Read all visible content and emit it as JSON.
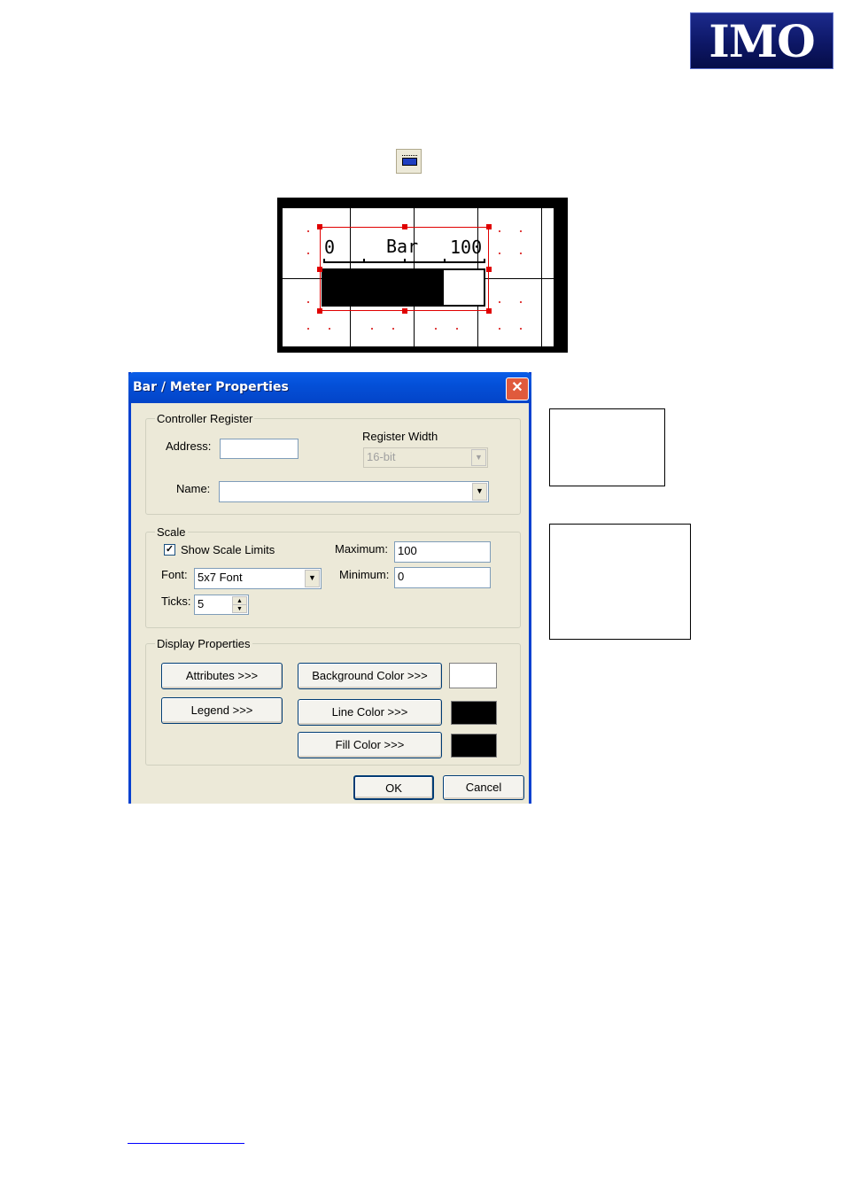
{
  "logo": {
    "text": "IMO"
  },
  "toolbar_icon": {
    "name": "bar-meter-tool-icon"
  },
  "preview": {
    "min_label": "0",
    "title_label": "Bar",
    "max_label": "100",
    "fill_fraction": 0.75
  },
  "dialog": {
    "title": "Bar / Meter Properties",
    "close_glyph": "✕",
    "controller_register": {
      "group_label": "Controller Register",
      "address_label": "Address:",
      "address_value": "",
      "register_width_label": "Register Width",
      "register_width_value": "16-bit",
      "name_label": "Name:",
      "name_value": ""
    },
    "scale": {
      "group_label": "Scale",
      "show_scale_limits_label": "Show Scale Limits",
      "show_scale_limits_checked": true,
      "font_label": "Font:",
      "font_value": "5x7 Font",
      "ticks_label": "Ticks:",
      "ticks_value": "5",
      "maximum_label": "Maximum:",
      "maximum_value": "100",
      "minimum_label": "Minimum:",
      "minimum_value": "0"
    },
    "display_properties": {
      "group_label": "Display Properties",
      "attributes_button": "Attributes >>>",
      "legend_button": "Legend >>>",
      "background_color_button": "Background Color >>>",
      "line_color_button": "Line Color >>>",
      "fill_color_button": "Fill Color >>>",
      "background_color": "#ffffff",
      "line_color": "#000000",
      "fill_color": "#000000"
    },
    "ok_button": "OK",
    "cancel_button": "Cancel"
  },
  "colors": {
    "titlebar": "#0450d8",
    "dialog_bg": "#ece9d8",
    "logo_bg": "#0d1766"
  }
}
